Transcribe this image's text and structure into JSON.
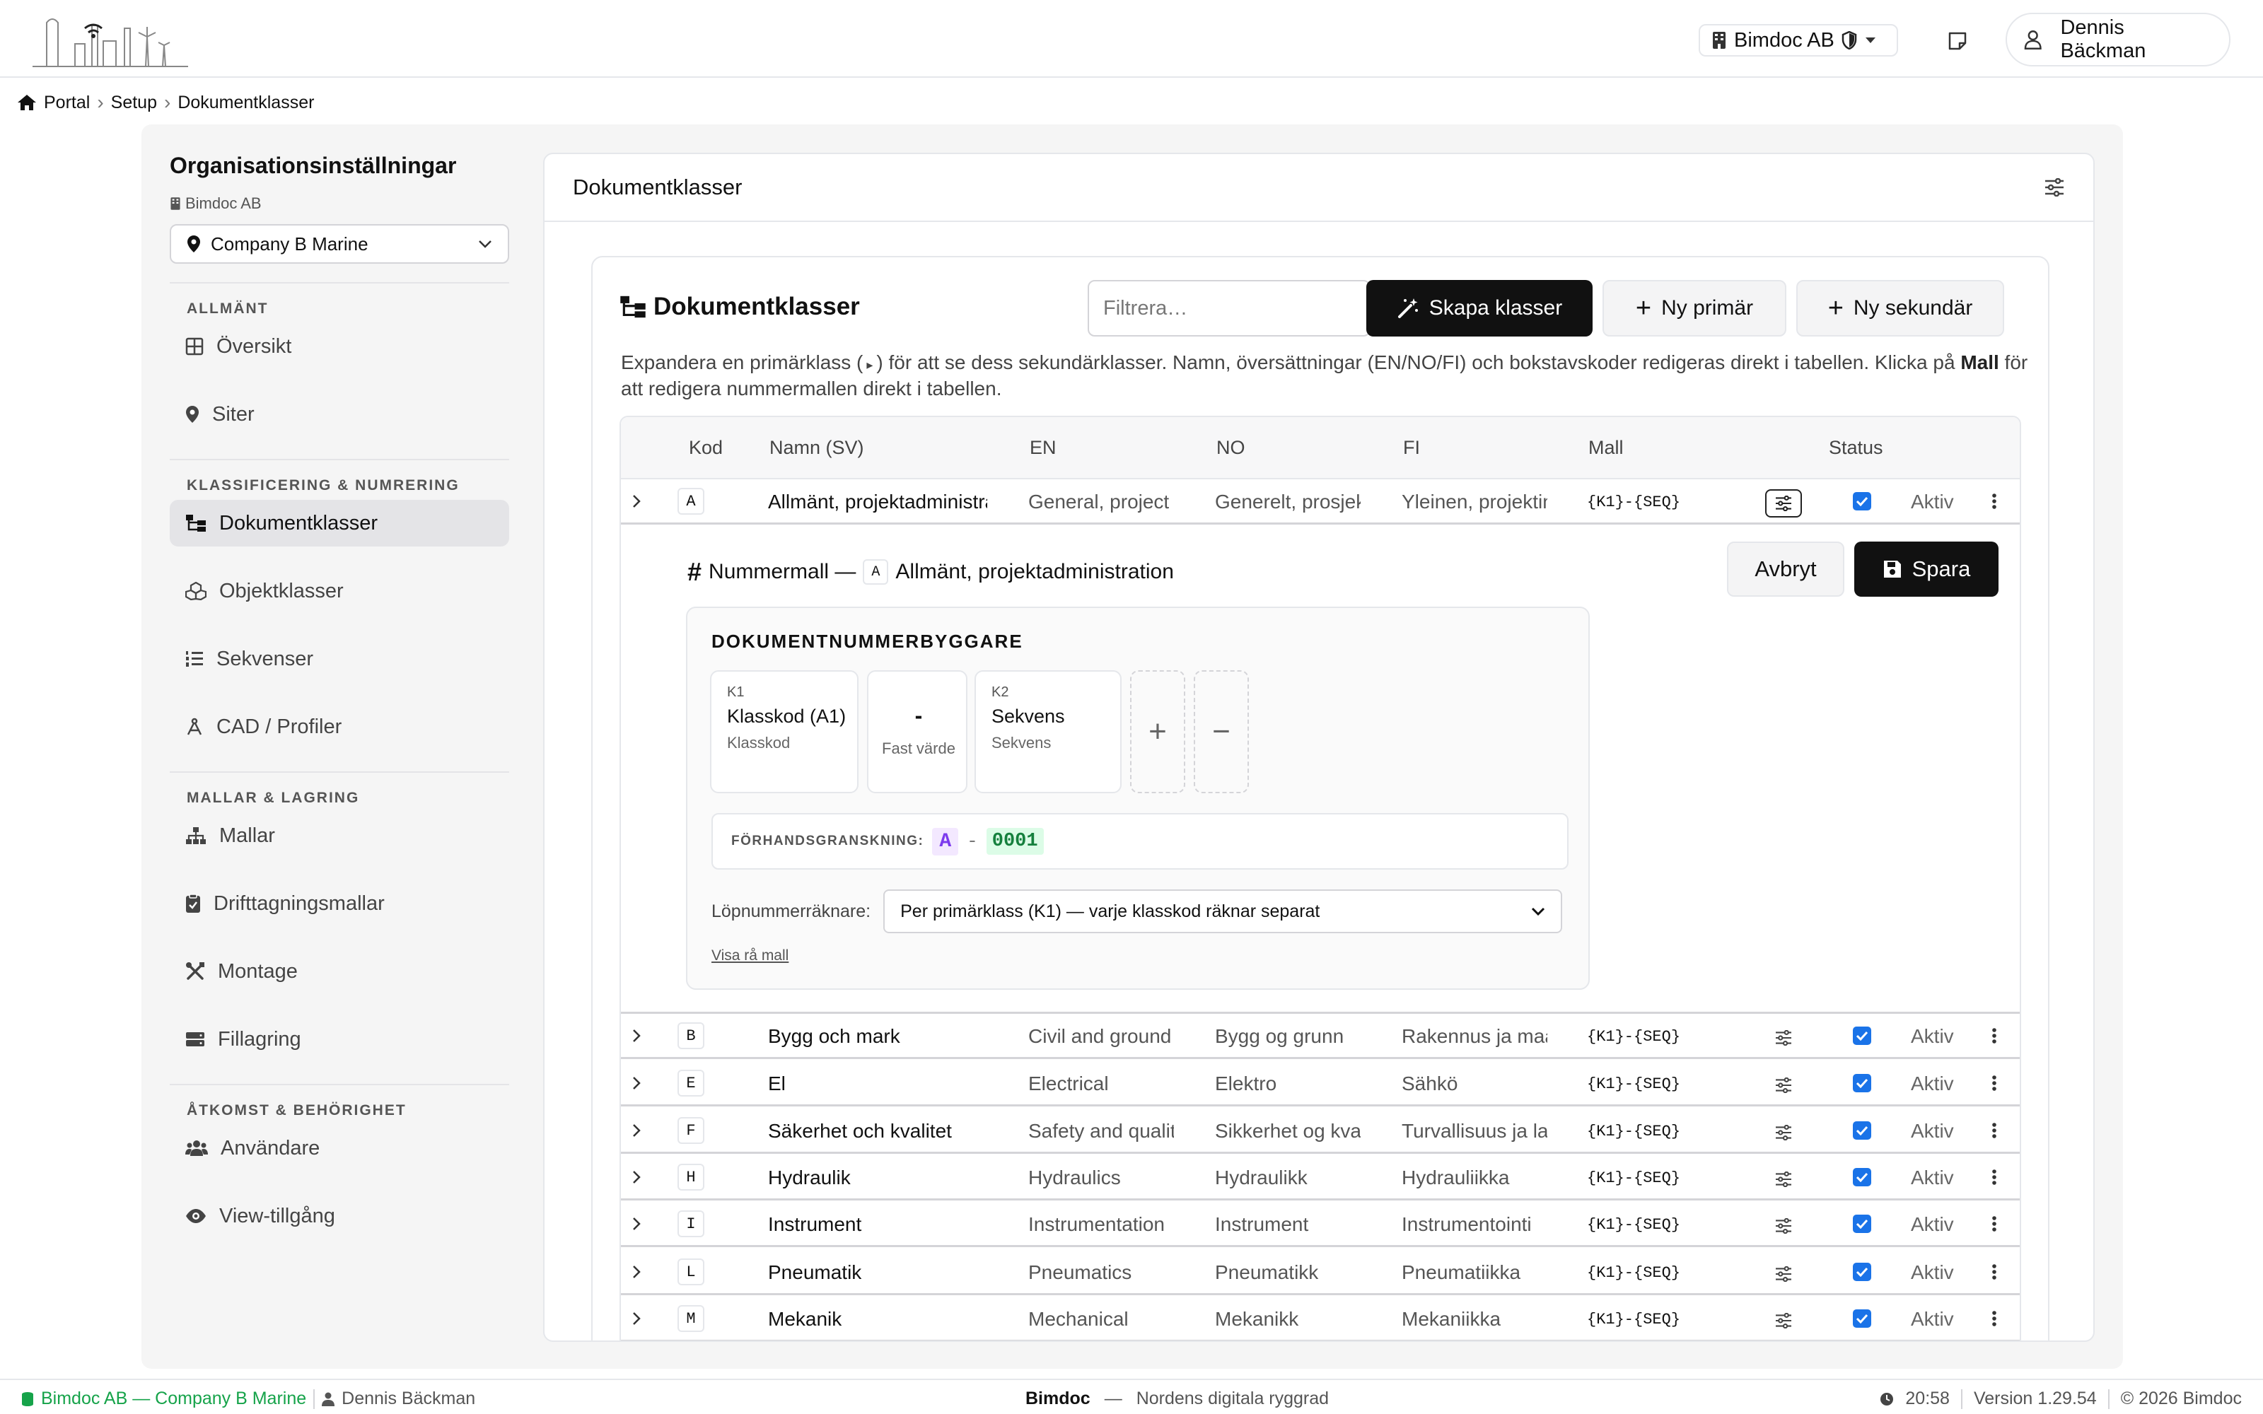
{
  "header": {
    "org_name": "Bimdoc AB",
    "user_name": "Dennis Bäckman"
  },
  "breadcrumb": [
    "Portal",
    "Setup",
    "Dokumentklasser"
  ],
  "sidebar": {
    "title": "Organisationsinställningar",
    "org": "Bimdoc AB",
    "site": "Company B Marine",
    "sections": [
      {
        "label": "ALLMÄNT",
        "items": [
          {
            "label": "Översikt",
            "icon": "grid-icon"
          },
          {
            "label": "Siter",
            "icon": "pin-icon"
          }
        ]
      },
      {
        "label": "KLASSIFICERING & NUMRERING",
        "items": [
          {
            "label": "Dokumentklasser",
            "icon": "tree-icon",
            "active": true
          },
          {
            "label": "Objektklasser",
            "icon": "cubes-icon"
          },
          {
            "label": "Sekvenser",
            "icon": "list-ol-icon"
          },
          {
            "label": "CAD / Profiler",
            "icon": "compass-icon"
          }
        ]
      },
      {
        "label": "MALLAR & LAGRING",
        "items": [
          {
            "label": "Mallar",
            "icon": "sitemap-icon"
          },
          {
            "label": "Drifttagningsmallar",
            "icon": "clipboard-check-icon"
          },
          {
            "label": "Montage",
            "icon": "tools-icon"
          },
          {
            "label": "Fillagring",
            "icon": "hdd-icon"
          }
        ]
      },
      {
        "label": "ÅTKOMST & BEHÖRIGHET",
        "items": [
          {
            "label": "Användare",
            "icon": "users-icon"
          },
          {
            "label": "View-tillgång",
            "icon": "eye-icon"
          }
        ]
      }
    ]
  },
  "card": {
    "title": "Dokumentklasser",
    "inner_title": "Dokumentklasser",
    "filter_placeholder": "Filtrera…",
    "btn_create": "Skapa klasser",
    "btn_primary": "Ny primär",
    "btn_secondary": "Ny sekundär",
    "desc_1": "Expandera en primärklass (",
    "desc_2": ") för att se dess sekundärklasser. Namn, översättningar (EN/NO/FI) och bokstavskoder redigeras direkt i tabellen. Klicka på ",
    "desc_bold": "Mall",
    "desc_3": " för att redigera nummermallen direkt i tabellen."
  },
  "table": {
    "columns": {
      "kod": "Kod",
      "namn": "Namn (SV)",
      "en": "EN",
      "no": "NO",
      "fi": "FI",
      "mall": "Mall",
      "status": "Status"
    },
    "rows": [
      {
        "kod": "A",
        "namn": "Allmänt, projektadministration",
        "en": "General, project",
        "no": "Generelt, prosjekt",
        "fi": "Yleinen, projektin",
        "mall": "{K1}-{SEQ}",
        "status": "Aktiv",
        "checked": true,
        "expanded": true
      },
      {
        "kod": "B",
        "namn": "Bygg och mark",
        "en": "Civil and ground",
        "no": "Bygg og grunn",
        "fi": "Rakennus ja maa",
        "mall": "{K1}-{SEQ}",
        "status": "Aktiv",
        "checked": true
      },
      {
        "kod": "E",
        "namn": "El",
        "en": "Electrical",
        "no": "Elektro",
        "fi": "Sähkö",
        "mall": "{K1}-{SEQ}",
        "status": "Aktiv",
        "checked": true
      },
      {
        "kod": "F",
        "namn": "Säkerhet och kvalitet",
        "en": "Safety and quality",
        "no": "Sikkerhet og kvalitet",
        "fi": "Turvallisuus ja laatu",
        "mall": "{K1}-{SEQ}",
        "status": "Aktiv",
        "checked": true
      },
      {
        "kod": "H",
        "namn": "Hydraulik",
        "en": "Hydraulics",
        "no": "Hydraulikk",
        "fi": "Hydrauliikka",
        "mall": "{K1}-{SEQ}",
        "status": "Aktiv",
        "checked": true
      },
      {
        "kod": "I",
        "namn": "Instrument",
        "en": "Instrumentation",
        "no": "Instrument",
        "fi": "Instrumentointi",
        "mall": "{K1}-{SEQ}",
        "status": "Aktiv",
        "checked": true
      },
      {
        "kod": "L",
        "namn": "Pneumatik",
        "en": "Pneumatics",
        "no": "Pneumatikk",
        "fi": "Pneumatiikka",
        "mall": "{K1}-{SEQ}",
        "status": "Aktiv",
        "checked": true
      },
      {
        "kod": "M",
        "namn": "Mekanik",
        "en": "Mechanical",
        "no": "Mekanikk",
        "fi": "Mekaniikka",
        "mall": "{K1}-{SEQ}",
        "status": "Aktiv",
        "checked": true
      }
    ]
  },
  "editor": {
    "title_prefix": "Nummermall —",
    "code": "A",
    "class_name": "Allmänt, projektadministration",
    "cancel": "Avbryt",
    "save": "Spara",
    "builder_title": "DOKUMENTNUMMERBYGGARE",
    "segments": [
      {
        "key": "K1",
        "title": "Klasskod (A1)",
        "sub": "Klasskod"
      },
      {
        "value": "-",
        "sub": "Fast värde"
      },
      {
        "key": "K2",
        "title": "Sekvens",
        "sub": "Sekvens"
      }
    ],
    "add": "+",
    "remove": "−",
    "preview_label": "FÖRHANDSGRANSKNING:",
    "preview_code": "A",
    "preview_sep": "-",
    "preview_seq": "0001",
    "counter_label": "Löpnummerräknare:",
    "counter_value": "Per primärklass (K1) — varje klasskod räknar separat",
    "raw_link": "Visa rå mall"
  },
  "footer": {
    "org_site": "Bimdoc AB — Company B Marine",
    "user": "Dennis Bäckman",
    "app": "Bimdoc",
    "dash": "—",
    "tagline": "Nordens digitala ryggrad",
    "time": "20:58",
    "version": "Version 1.29.54",
    "copyright": "© 2026 Bimdoc"
  },
  "colors": {
    "accent": "#111111",
    "checkbox": "#1a73e8",
    "footer_org": "#16a34a",
    "preview_code_bg": "#f3e8ff",
    "preview_seq_bg": "#dcfce7"
  }
}
